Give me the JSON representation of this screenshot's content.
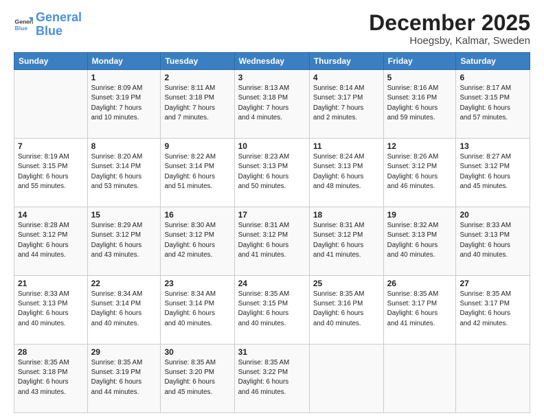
{
  "header": {
    "logo_line1": "General",
    "logo_line2": "Blue",
    "month": "December 2025",
    "location": "Hoegsby, Kalmar, Sweden"
  },
  "weekdays": [
    "Sunday",
    "Monday",
    "Tuesday",
    "Wednesday",
    "Thursday",
    "Friday",
    "Saturday"
  ],
  "weeks": [
    [
      {
        "day": "",
        "info": ""
      },
      {
        "day": "1",
        "info": "Sunrise: 8:09 AM\nSunset: 3:19 PM\nDaylight: 7 hours\nand 10 minutes."
      },
      {
        "day": "2",
        "info": "Sunrise: 8:11 AM\nSunset: 3:18 PM\nDaylight: 7 hours\nand 7 minutes."
      },
      {
        "day": "3",
        "info": "Sunrise: 8:13 AM\nSunset: 3:18 PM\nDaylight: 7 hours\nand 4 minutes."
      },
      {
        "day": "4",
        "info": "Sunrise: 8:14 AM\nSunset: 3:17 PM\nDaylight: 7 hours\nand 2 minutes."
      },
      {
        "day": "5",
        "info": "Sunrise: 8:16 AM\nSunset: 3:16 PM\nDaylight: 6 hours\nand 59 minutes."
      },
      {
        "day": "6",
        "info": "Sunrise: 8:17 AM\nSunset: 3:15 PM\nDaylight: 6 hours\nand 57 minutes."
      }
    ],
    [
      {
        "day": "7",
        "info": "Sunrise: 8:19 AM\nSunset: 3:15 PM\nDaylight: 6 hours\nand 55 minutes."
      },
      {
        "day": "8",
        "info": "Sunrise: 8:20 AM\nSunset: 3:14 PM\nDaylight: 6 hours\nand 53 minutes."
      },
      {
        "day": "9",
        "info": "Sunrise: 8:22 AM\nSunset: 3:14 PM\nDaylight: 6 hours\nand 51 minutes."
      },
      {
        "day": "10",
        "info": "Sunrise: 8:23 AM\nSunset: 3:13 PM\nDaylight: 6 hours\nand 50 minutes."
      },
      {
        "day": "11",
        "info": "Sunrise: 8:24 AM\nSunset: 3:13 PM\nDaylight: 6 hours\nand 48 minutes."
      },
      {
        "day": "12",
        "info": "Sunrise: 8:26 AM\nSunset: 3:12 PM\nDaylight: 6 hours\nand 46 minutes."
      },
      {
        "day": "13",
        "info": "Sunrise: 8:27 AM\nSunset: 3:12 PM\nDaylight: 6 hours\nand 45 minutes."
      }
    ],
    [
      {
        "day": "14",
        "info": "Sunrise: 8:28 AM\nSunset: 3:12 PM\nDaylight: 6 hours\nand 44 minutes."
      },
      {
        "day": "15",
        "info": "Sunrise: 8:29 AM\nSunset: 3:12 PM\nDaylight: 6 hours\nand 43 minutes."
      },
      {
        "day": "16",
        "info": "Sunrise: 8:30 AM\nSunset: 3:12 PM\nDaylight: 6 hours\nand 42 minutes."
      },
      {
        "day": "17",
        "info": "Sunrise: 8:31 AM\nSunset: 3:12 PM\nDaylight: 6 hours\nand 41 minutes."
      },
      {
        "day": "18",
        "info": "Sunrise: 8:31 AM\nSunset: 3:12 PM\nDaylight: 6 hours\nand 41 minutes."
      },
      {
        "day": "19",
        "info": "Sunrise: 8:32 AM\nSunset: 3:13 PM\nDaylight: 6 hours\nand 40 minutes."
      },
      {
        "day": "20",
        "info": "Sunrise: 8:33 AM\nSunset: 3:13 PM\nDaylight: 6 hours\nand 40 minutes."
      }
    ],
    [
      {
        "day": "21",
        "info": "Sunrise: 8:33 AM\nSunset: 3:13 PM\nDaylight: 6 hours\nand 40 minutes."
      },
      {
        "day": "22",
        "info": "Sunrise: 8:34 AM\nSunset: 3:14 PM\nDaylight: 6 hours\nand 40 minutes."
      },
      {
        "day": "23",
        "info": "Sunrise: 8:34 AM\nSunset: 3:14 PM\nDaylight: 6 hours\nand 40 minutes."
      },
      {
        "day": "24",
        "info": "Sunrise: 8:35 AM\nSunset: 3:15 PM\nDaylight: 6 hours\nand 40 minutes."
      },
      {
        "day": "25",
        "info": "Sunrise: 8:35 AM\nSunset: 3:16 PM\nDaylight: 6 hours\nand 40 minutes."
      },
      {
        "day": "26",
        "info": "Sunrise: 8:35 AM\nSunset: 3:17 PM\nDaylight: 6 hours\nand 41 minutes."
      },
      {
        "day": "27",
        "info": "Sunrise: 8:35 AM\nSunset: 3:17 PM\nDaylight: 6 hours\nand 42 minutes."
      }
    ],
    [
      {
        "day": "28",
        "info": "Sunrise: 8:35 AM\nSunset: 3:18 PM\nDaylight: 6 hours\nand 43 minutes."
      },
      {
        "day": "29",
        "info": "Sunrise: 8:35 AM\nSunset: 3:19 PM\nDaylight: 6 hours\nand 44 minutes."
      },
      {
        "day": "30",
        "info": "Sunrise: 8:35 AM\nSunset: 3:20 PM\nDaylight: 6 hours\nand 45 minutes."
      },
      {
        "day": "31",
        "info": "Sunrise: 8:35 AM\nSunset: 3:22 PM\nDaylight: 6 hours\nand 46 minutes."
      },
      {
        "day": "",
        "info": ""
      },
      {
        "day": "",
        "info": ""
      },
      {
        "day": "",
        "info": ""
      }
    ]
  ]
}
